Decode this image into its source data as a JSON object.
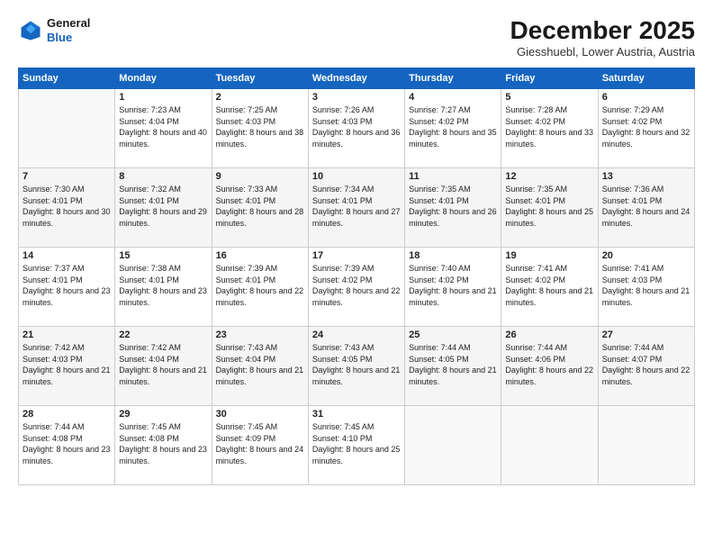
{
  "logo": {
    "line1": "General",
    "line2": "Blue"
  },
  "title": "December 2025",
  "location": "Giesshuebl, Lower Austria, Austria",
  "days_of_week": [
    "Sunday",
    "Monday",
    "Tuesday",
    "Wednesday",
    "Thursday",
    "Friday",
    "Saturday"
  ],
  "weeks": [
    [
      {
        "day": "",
        "sunrise": "",
        "sunset": "",
        "daylight": ""
      },
      {
        "day": "1",
        "sunrise": "Sunrise: 7:23 AM",
        "sunset": "Sunset: 4:04 PM",
        "daylight": "Daylight: 8 hours and 40 minutes."
      },
      {
        "day": "2",
        "sunrise": "Sunrise: 7:25 AM",
        "sunset": "Sunset: 4:03 PM",
        "daylight": "Daylight: 8 hours and 38 minutes."
      },
      {
        "day": "3",
        "sunrise": "Sunrise: 7:26 AM",
        "sunset": "Sunset: 4:03 PM",
        "daylight": "Daylight: 8 hours and 36 minutes."
      },
      {
        "day": "4",
        "sunrise": "Sunrise: 7:27 AM",
        "sunset": "Sunset: 4:02 PM",
        "daylight": "Daylight: 8 hours and 35 minutes."
      },
      {
        "day": "5",
        "sunrise": "Sunrise: 7:28 AM",
        "sunset": "Sunset: 4:02 PM",
        "daylight": "Daylight: 8 hours and 33 minutes."
      },
      {
        "day": "6",
        "sunrise": "Sunrise: 7:29 AM",
        "sunset": "Sunset: 4:02 PM",
        "daylight": "Daylight: 8 hours and 32 minutes."
      }
    ],
    [
      {
        "day": "7",
        "sunrise": "Sunrise: 7:30 AM",
        "sunset": "Sunset: 4:01 PM",
        "daylight": "Daylight: 8 hours and 30 minutes."
      },
      {
        "day": "8",
        "sunrise": "Sunrise: 7:32 AM",
        "sunset": "Sunset: 4:01 PM",
        "daylight": "Daylight: 8 hours and 29 minutes."
      },
      {
        "day": "9",
        "sunrise": "Sunrise: 7:33 AM",
        "sunset": "Sunset: 4:01 PM",
        "daylight": "Daylight: 8 hours and 28 minutes."
      },
      {
        "day": "10",
        "sunrise": "Sunrise: 7:34 AM",
        "sunset": "Sunset: 4:01 PM",
        "daylight": "Daylight: 8 hours and 27 minutes."
      },
      {
        "day": "11",
        "sunrise": "Sunrise: 7:35 AM",
        "sunset": "Sunset: 4:01 PM",
        "daylight": "Daylight: 8 hours and 26 minutes."
      },
      {
        "day": "12",
        "sunrise": "Sunrise: 7:35 AM",
        "sunset": "Sunset: 4:01 PM",
        "daylight": "Daylight: 8 hours and 25 minutes."
      },
      {
        "day": "13",
        "sunrise": "Sunrise: 7:36 AM",
        "sunset": "Sunset: 4:01 PM",
        "daylight": "Daylight: 8 hours and 24 minutes."
      }
    ],
    [
      {
        "day": "14",
        "sunrise": "Sunrise: 7:37 AM",
        "sunset": "Sunset: 4:01 PM",
        "daylight": "Daylight: 8 hours and 23 minutes."
      },
      {
        "day": "15",
        "sunrise": "Sunrise: 7:38 AM",
        "sunset": "Sunset: 4:01 PM",
        "daylight": "Daylight: 8 hours and 23 minutes."
      },
      {
        "day": "16",
        "sunrise": "Sunrise: 7:39 AM",
        "sunset": "Sunset: 4:01 PM",
        "daylight": "Daylight: 8 hours and 22 minutes."
      },
      {
        "day": "17",
        "sunrise": "Sunrise: 7:39 AM",
        "sunset": "Sunset: 4:02 PM",
        "daylight": "Daylight: 8 hours and 22 minutes."
      },
      {
        "day": "18",
        "sunrise": "Sunrise: 7:40 AM",
        "sunset": "Sunset: 4:02 PM",
        "daylight": "Daylight: 8 hours and 21 minutes."
      },
      {
        "day": "19",
        "sunrise": "Sunrise: 7:41 AM",
        "sunset": "Sunset: 4:02 PM",
        "daylight": "Daylight: 8 hours and 21 minutes."
      },
      {
        "day": "20",
        "sunrise": "Sunrise: 7:41 AM",
        "sunset": "Sunset: 4:03 PM",
        "daylight": "Daylight: 8 hours and 21 minutes."
      }
    ],
    [
      {
        "day": "21",
        "sunrise": "Sunrise: 7:42 AM",
        "sunset": "Sunset: 4:03 PM",
        "daylight": "Daylight: 8 hours and 21 minutes."
      },
      {
        "day": "22",
        "sunrise": "Sunrise: 7:42 AM",
        "sunset": "Sunset: 4:04 PM",
        "daylight": "Daylight: 8 hours and 21 minutes."
      },
      {
        "day": "23",
        "sunrise": "Sunrise: 7:43 AM",
        "sunset": "Sunset: 4:04 PM",
        "daylight": "Daylight: 8 hours and 21 minutes."
      },
      {
        "day": "24",
        "sunrise": "Sunrise: 7:43 AM",
        "sunset": "Sunset: 4:05 PM",
        "daylight": "Daylight: 8 hours and 21 minutes."
      },
      {
        "day": "25",
        "sunrise": "Sunrise: 7:44 AM",
        "sunset": "Sunset: 4:05 PM",
        "daylight": "Daylight: 8 hours and 21 minutes."
      },
      {
        "day": "26",
        "sunrise": "Sunrise: 7:44 AM",
        "sunset": "Sunset: 4:06 PM",
        "daylight": "Daylight: 8 hours and 22 minutes."
      },
      {
        "day": "27",
        "sunrise": "Sunrise: 7:44 AM",
        "sunset": "Sunset: 4:07 PM",
        "daylight": "Daylight: 8 hours and 22 minutes."
      }
    ],
    [
      {
        "day": "28",
        "sunrise": "Sunrise: 7:44 AM",
        "sunset": "Sunset: 4:08 PM",
        "daylight": "Daylight: 8 hours and 23 minutes."
      },
      {
        "day": "29",
        "sunrise": "Sunrise: 7:45 AM",
        "sunset": "Sunset: 4:08 PM",
        "daylight": "Daylight: 8 hours and 23 minutes."
      },
      {
        "day": "30",
        "sunrise": "Sunrise: 7:45 AM",
        "sunset": "Sunset: 4:09 PM",
        "daylight": "Daylight: 8 hours and 24 minutes."
      },
      {
        "day": "31",
        "sunrise": "Sunrise: 7:45 AM",
        "sunset": "Sunset: 4:10 PM",
        "daylight": "Daylight: 8 hours and 25 minutes."
      },
      {
        "day": "",
        "sunrise": "",
        "sunset": "",
        "daylight": ""
      },
      {
        "day": "",
        "sunrise": "",
        "sunset": "",
        "daylight": ""
      },
      {
        "day": "",
        "sunrise": "",
        "sunset": "",
        "daylight": ""
      }
    ]
  ]
}
